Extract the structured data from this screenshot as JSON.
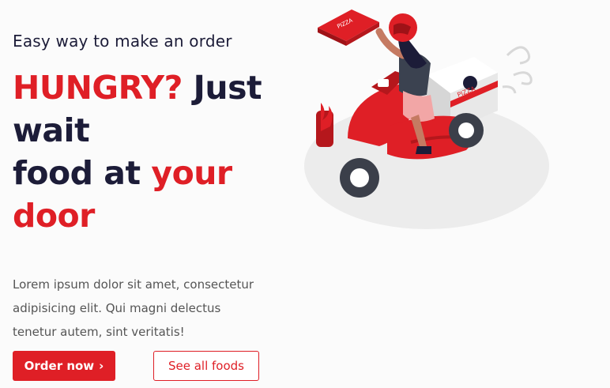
{
  "hero": {
    "subtitle": "Easy way to make an order",
    "headline": {
      "part1": "HUNGRY?",
      "part2": "Just",
      "part3": "wait",
      "part4": "food at",
      "part5": "your",
      "part6": "door"
    },
    "description": "Lorem ipsum dolor sit amet, consectetur adipisicing elit. Qui magni delectus tenetur autem, sint veritatis!"
  },
  "buttons": {
    "order": "Order now",
    "see_all": "See all foods"
  },
  "illustration": {
    "box_label": "PIZZA",
    "scooter_label": "PIZZA"
  },
  "colors": {
    "accent": "#df1f26",
    "dark": "#1c1c38",
    "background": "#fbfbfb"
  },
  "icons": {
    "order_button": "chevron-right-icon"
  }
}
